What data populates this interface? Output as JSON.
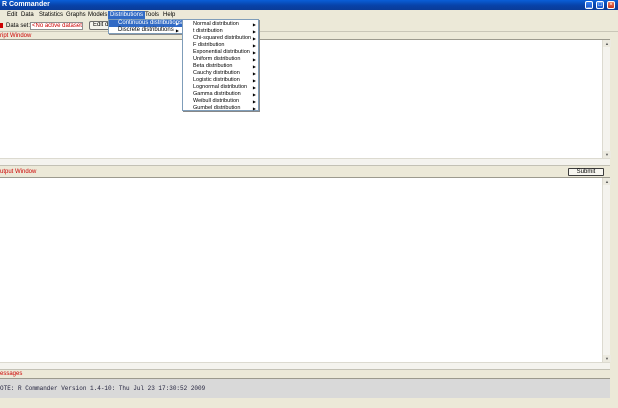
{
  "window": {
    "title": "R Commander"
  },
  "menubar": {
    "items": [
      "Edit",
      "Data",
      "Statistics",
      "Graphs",
      "Models",
      "Distributions",
      "Tools",
      "Help"
    ],
    "active_index": 5
  },
  "toolbar": {
    "dataset_label": "Data set:",
    "dataset_value": "<No active dataset>",
    "edit_button": "Edit data set"
  },
  "script_window": {
    "label": "ript Window"
  },
  "output_window": {
    "label": "utput Window",
    "submit_label": "Submit"
  },
  "messages": {
    "label": "essages",
    "text": "OTE: R Commander Version 1.4-10: Thu Jul 23 17:30:52 2009"
  },
  "distributions_menu": {
    "items": [
      {
        "label": "Continuous distributions",
        "active": true
      },
      {
        "label": "Discrete distributions",
        "active": false
      }
    ]
  },
  "continuous_submenu": {
    "items": [
      "Normal distribution",
      "t distribution",
      "Chi-squared distribution",
      "F distribution",
      "Exponential distribution",
      "Uniform distribution",
      "Beta distribution",
      "Cauchy distribution",
      "Logistic distribution",
      "Lognormal distribution",
      "Gamma distribution",
      "Weibull distribution",
      "Gumbel distribution"
    ]
  },
  "icons": {
    "submenu_arrow": "▶",
    "minimize": "_",
    "maximize": "□",
    "close": "×"
  },
  "colors": {
    "titlebar": "#0842a8",
    "menu_highlight": "#316ac5",
    "label_red": "#cc0000"
  }
}
